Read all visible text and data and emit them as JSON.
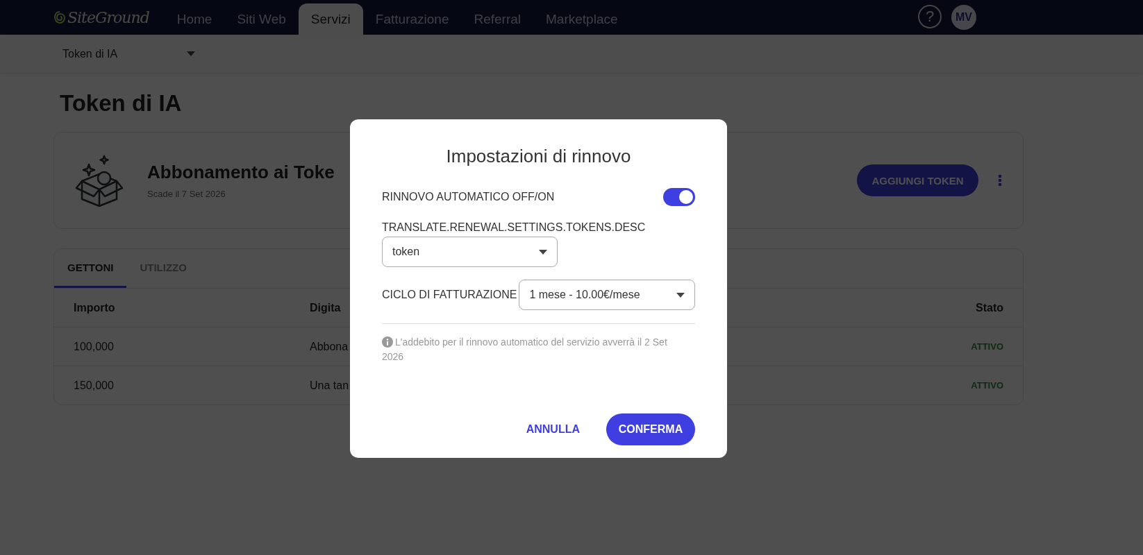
{
  "header": {
    "logo": "SiteGround",
    "nav": [
      {
        "label": "Home",
        "selected": false
      },
      {
        "label": "Siti Web",
        "selected": false
      },
      {
        "label": "Servizi",
        "selected": true
      },
      {
        "label": "Fatturazione",
        "selected": false
      },
      {
        "label": "Referral",
        "selected": false
      },
      {
        "label": "Marketplace",
        "selected": false
      }
    ],
    "help": "?",
    "avatar": "MV"
  },
  "subnav": {
    "dropdown": "Token di IA"
  },
  "page_title": "Token di IA",
  "subscription": {
    "title": "Abbonamento ai Toke",
    "subtitle": "Scade il 7 Set 2026",
    "button": "AGGIUNGI TOKEN"
  },
  "tabs": [
    {
      "label": "GETTONI",
      "selected": true
    },
    {
      "label": "UTILIZZO",
      "selected": false
    }
  ],
  "table": {
    "columns": [
      "Importo",
      "Digita",
      "Stato"
    ],
    "rows": [
      {
        "cells": [
          "100,000",
          "Abbona",
          "ATTIVO"
        ]
      },
      {
        "cells": [
          "150,000",
          "Una tan",
          "ATTIVO"
        ]
      }
    ]
  },
  "modal": {
    "title": "Impostazioni di rinnovo",
    "auto_renew": {
      "label": "RINNOVO AUTOMATICO OFF/ON",
      "on": true
    },
    "tokens": {
      "label": "TRANSLATE.RENEWAL.SETTINGS.TOKENS.DESC",
      "value": "token"
    },
    "billing": {
      "label": "CICLO DI FATTURAZIONE",
      "value": "1 mese - 10.00€/mese"
    },
    "note": "L'addebito per il rinnovo automatico del servizio avverrà il 2 Set 2026",
    "buttons": [
      {
        "label": "ANNULLA",
        "kind": "text"
      },
      {
        "label": "CONFERMA",
        "kind": "primary"
      }
    ]
  }
}
